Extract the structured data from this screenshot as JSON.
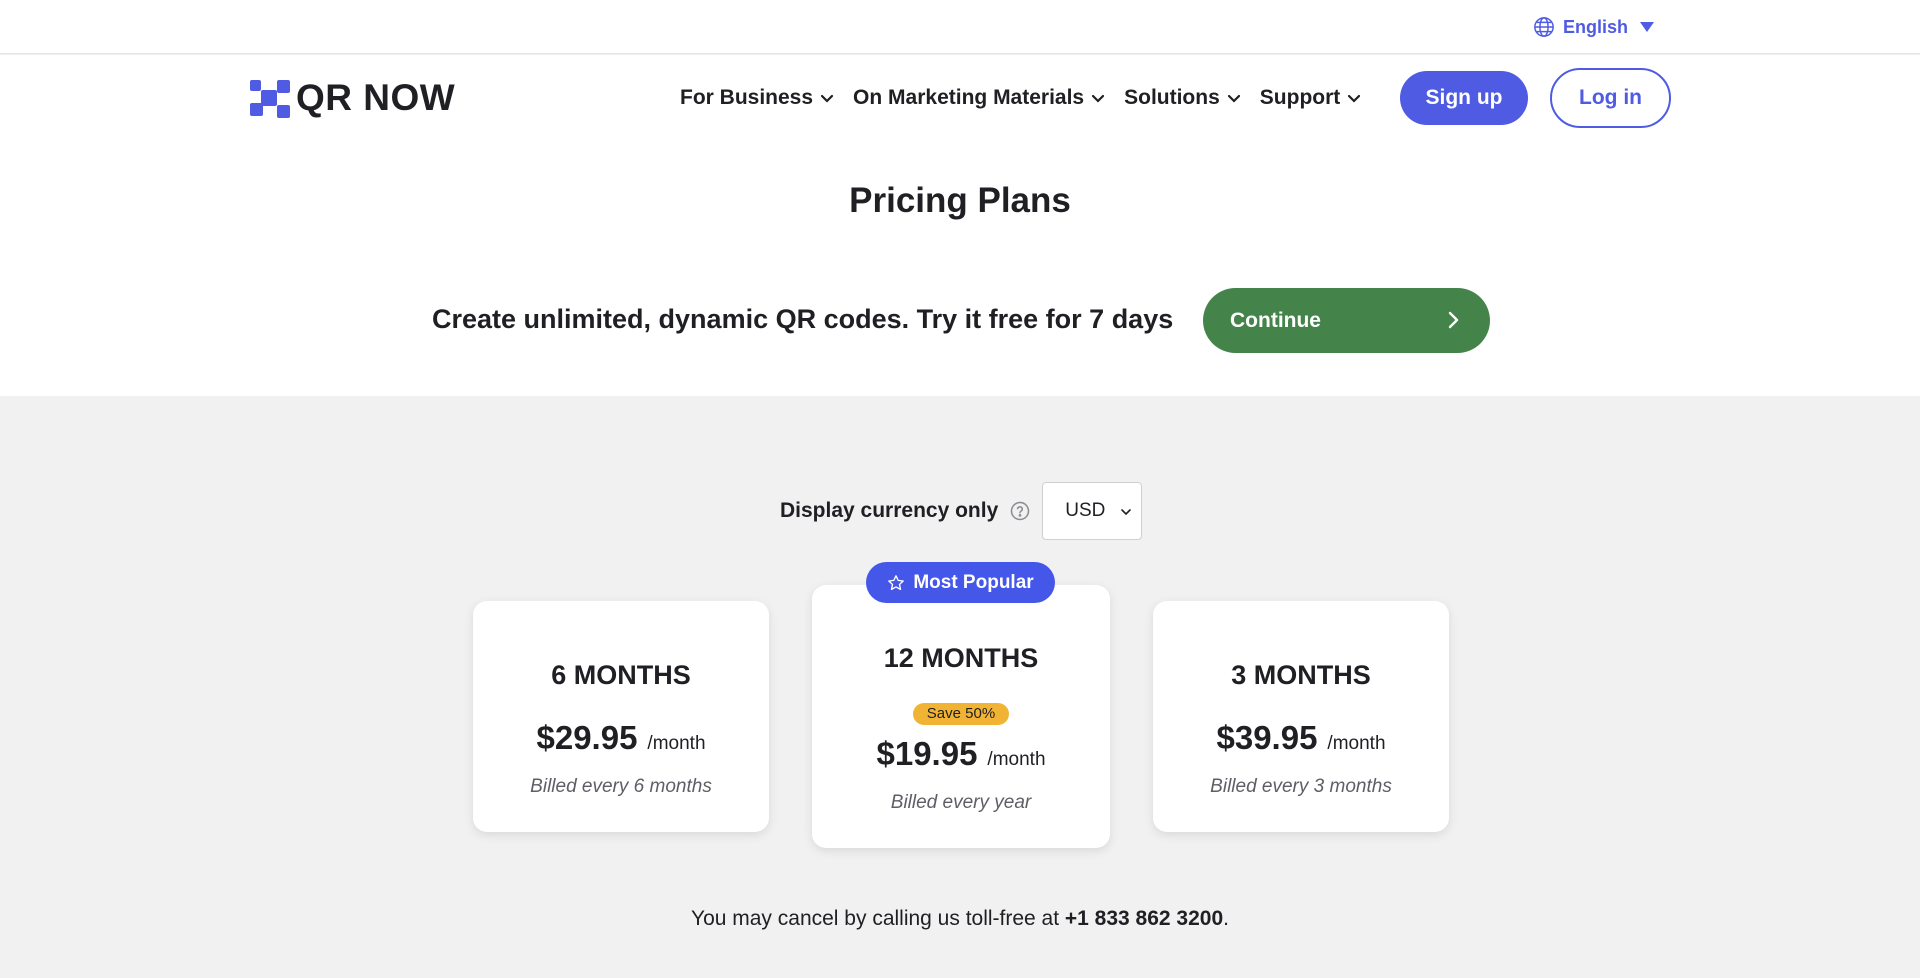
{
  "topbar": {
    "language": "English"
  },
  "nav": {
    "logo_text": "QR NOW",
    "menu": [
      {
        "label": "For Business"
      },
      {
        "label": "On Marketing Materials"
      },
      {
        "label": "Solutions"
      },
      {
        "label": "Support"
      }
    ],
    "signup_label": "Sign up",
    "login_label": "Log in"
  },
  "hero": {
    "title": "Pricing Plans",
    "tagline": "Create unlimited, dynamic QR codes. Try it free for 7 days",
    "continue_label": "Continue"
  },
  "currency": {
    "label": "Display currency only",
    "selected": "USD"
  },
  "plans": [
    {
      "term": "6 MONTHS",
      "price": "$29.95",
      "per": "/month",
      "billed": "Billed every 6 months"
    },
    {
      "term": "12 MONTHS",
      "badge": "Most Popular",
      "save": "Save 50%",
      "price": "$19.95",
      "per": "/month",
      "billed": "Billed every year"
    },
    {
      "term": "3 MONTHS",
      "price": "$39.95",
      "per": "/month",
      "billed": "Billed every 3 months"
    }
  ],
  "footer_note": {
    "text_before": "You may cancel by calling us toll-free at ",
    "phone": "+1 833 862 3200",
    "text_after": "."
  },
  "colors": {
    "brand_blue": "#4f5be3",
    "continue_green": "#44844a",
    "save_badge": "#f1b334",
    "background_gray": "#f1f1f1"
  }
}
